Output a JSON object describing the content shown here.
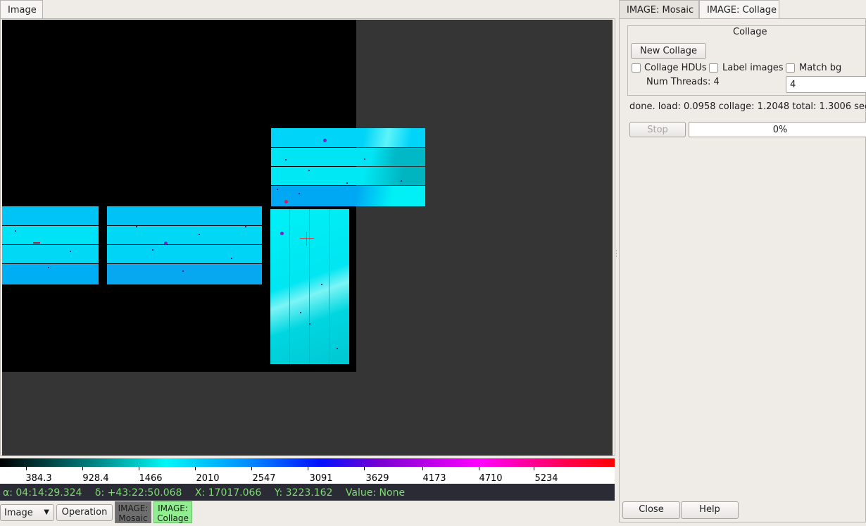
{
  "left_tabs": [
    {
      "label": "Image"
    }
  ],
  "right_tabs": [
    {
      "label": "IMAGE: Mosaic"
    },
    {
      "label": "IMAGE: Collage"
    }
  ],
  "collage_panel": {
    "title": "Collage",
    "new_collage_label": "New Collage",
    "collage_hdus_label": "Collage HDUs",
    "label_images_label": "Label images",
    "match_bg_label": "Match bg",
    "num_threads_label": "Num Threads: 4",
    "num_threads_value": "4",
    "status_text": "done. load: 0.0958 collage: 1.2048 total: 1.3006 sec",
    "stop_label": "Stop",
    "progress_text": "0%",
    "progress_value": 0
  },
  "footer_buttons": {
    "close_label": "Close",
    "help_label": "Help"
  },
  "colorbar": {
    "labels": [
      "384.3",
      "928.4",
      "1466",
      "2010",
      "2547",
      "3091",
      "3629",
      "4173",
      "4710",
      "5234"
    ],
    "colormap": "rainbow"
  },
  "status_bar": {
    "ra": "α: 04:14:29.324",
    "dec": "δ: +43:22:50.068",
    "x": "X: 17017.066",
    "y": "Y: 3223.162",
    "value": "Value: None"
  },
  "bottom_toolbar": {
    "image_select_value": "Image",
    "operation_label": "Operation",
    "channel_mosaic_line1": "IMAGE:",
    "channel_mosaic_line2": "Mosaic",
    "channel_collage_line1": "IMAGE:",
    "channel_collage_line2": "Collage"
  },
  "colors": {
    "status_text": "#7ddb72",
    "status_bg": "#2b2b36",
    "tile_cyan": "#00e8f4",
    "tile_blue": "#08b0f6",
    "active_channel": "#90ee90",
    "inactive_channel": "#6e6e6e"
  }
}
